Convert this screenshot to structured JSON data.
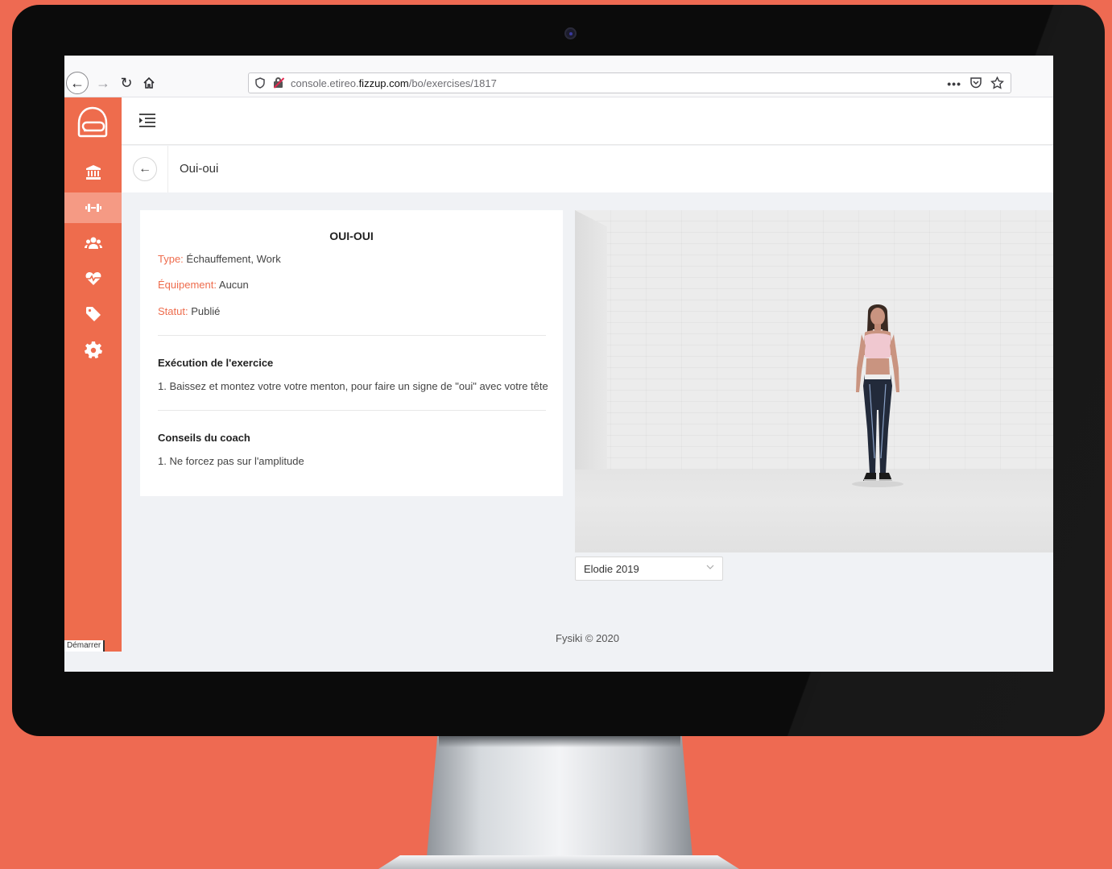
{
  "browser": {
    "url_prefix": "console.etireo.",
    "url_domain": "fizzup.com",
    "url_path": "/bo/exercises/1817",
    "icons": [
      "back-icon",
      "forward-icon",
      "reload-icon",
      "home-icon",
      "shield-icon",
      "insecure-lock-icon",
      "more-icon",
      "pocket-icon",
      "bookmark-star-icon"
    ]
  },
  "sidebar": {
    "items": [
      {
        "name": "museum-icon",
        "active": false
      },
      {
        "name": "dumbbell-icon",
        "active": true
      },
      {
        "name": "users-icon",
        "active": false
      },
      {
        "name": "heartbeat-icon",
        "active": false
      },
      {
        "name": "tag-icon",
        "active": false
      },
      {
        "name": "gear-icon",
        "active": false
      }
    ],
    "start_label": "Démarrer"
  },
  "page": {
    "title": "Oui-oui"
  },
  "exercise": {
    "name": "OUI-OUI",
    "type_label": "Type:",
    "type_value": "Échauffement, Work",
    "equipment_label": "Équipement:",
    "equipment_value": "Aucun",
    "status_label": "Statut:",
    "status_value": "Publié",
    "execution_title": "Exécution de l'exercice",
    "execution_step": "1. Baissez et montez votre votre menton, pour faire un signe de \"oui\" avec votre tête",
    "tips_title": "Conseils du coach",
    "tips_step": "1. Ne forcez pas sur l'amplitude"
  },
  "coach_select": {
    "value": "Elodie 2019"
  },
  "footer": {
    "text": "Fysiki © 2020"
  },
  "colors": {
    "brand": "#ee6c4d",
    "background": "#ee6a52"
  }
}
